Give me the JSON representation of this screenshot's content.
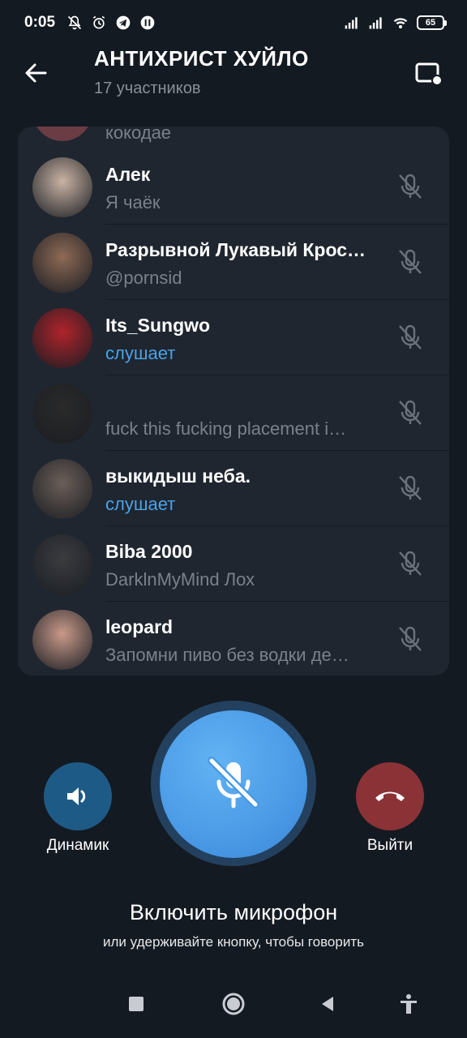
{
  "status_bar": {
    "time": "0:05",
    "battery": "65",
    "left_icons": [
      "mute-bell-icon",
      "alarm-icon",
      "telegram-icon",
      "app-icon"
    ],
    "right_icons": [
      "signal-icon",
      "signal-icon",
      "wifi-icon"
    ]
  },
  "header": {
    "title": "АНТИХРИСТ ХУЙЛО",
    "subtitle": "17 участников"
  },
  "participants": {
    "partial_status": "кокодае",
    "items": [
      {
        "name": "Алек",
        "status": "Я чаёк",
        "listening": false,
        "avatar_color": "#c9b3a4"
      },
      {
        "name": "Разрывной Лукавый Крос…",
        "status": "@pornsid",
        "listening": false,
        "avatar_color": "#8e6a55"
      },
      {
        "name": "Its_Sungwo",
        "status": "слушает",
        "listening": true,
        "avatar_color": "#b0232b"
      },
      {
        "name": "",
        "status": "fuck this fucking placement i…",
        "listening": false,
        "avatar_color": "#2a2a2a"
      },
      {
        "name": "выкидыш неба.",
        "status": "слушает",
        "listening": true,
        "avatar_color": "#6b5e58"
      },
      {
        "name": "Biba 2000",
        "status": "DarklnMyMind Лох",
        "listening": false,
        "avatar_color": "#3a3c40"
      },
      {
        "name": "leopard",
        "status": "Запомни пиво без водки де…",
        "listening": false,
        "avatar_color": "#c99a8a"
      }
    ]
  },
  "controls": {
    "speaker_label": "Динамик",
    "leave_label": "Выйти",
    "mic_title": "Включить микрофон",
    "mic_hint": "или удерживайте кнопку, чтобы говорить"
  },
  "colors": {
    "background": "#141a22",
    "card": "#1f2630",
    "accent": "#4aa3e8",
    "speaker": "#1e5a86",
    "leave": "#8a3236"
  }
}
